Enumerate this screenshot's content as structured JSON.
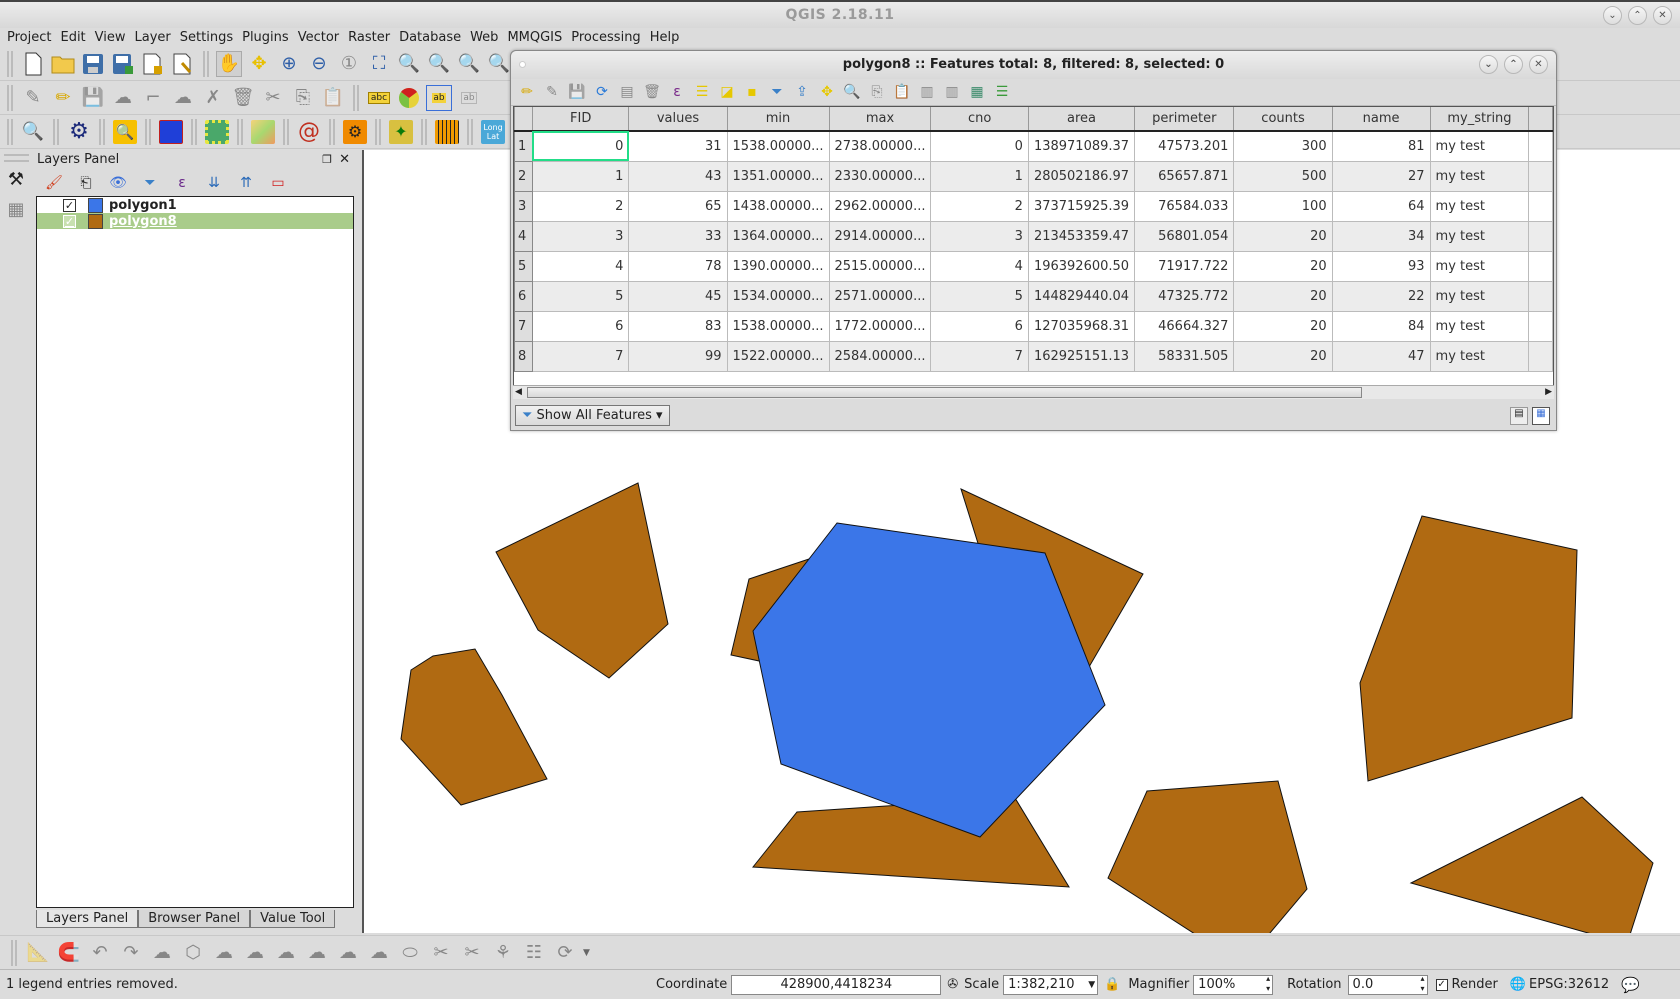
{
  "window": {
    "title": "QGIS 2.18.11",
    "controls": [
      "minimize",
      "maximize",
      "close"
    ]
  },
  "menu": [
    "Project",
    "Edit",
    "View",
    "Layer",
    "Settings",
    "Plugins",
    "Vector",
    "Raster",
    "Database",
    "Web",
    "MMQGIS",
    "Processing",
    "Help"
  ],
  "toolbar1": [
    "new-project-icon",
    "open-project-icon",
    "save-project-icon",
    "save-as-icon",
    "new-print-composer-icon",
    "composer-manager-icon",
    "pan-icon",
    "pan-to-selection-icon",
    "zoom-in-icon",
    "zoom-out-icon",
    "zoom-native-icon",
    "zoom-full-icon",
    "zoom-to-selection-icon",
    "zoom-to-layer-icon",
    "zoom-last-icon",
    "zoom-next-icon"
  ],
  "toolbar2": [
    "current-edits-icon",
    "toggle-editing-icon",
    "save-edits-icon",
    "add-feature-icon",
    "node-tool-icon",
    "move-feature-icon",
    "delete-part-icon",
    "delete-selected-icon",
    "cut-features-icon",
    "copy-features-icon",
    "paste-features-icon",
    "label-icon",
    "diagram-icon",
    "pin-labels-icon",
    "show-hide-labels-icon"
  ],
  "toolbar3": {
    "long_lat_label": "Long\nLat",
    "icons": [
      "geoprocessing-search-icon",
      "processing-gear-icon",
      "search-plugin-icon",
      "network-plugin-icon",
      "grid-plugin-icon",
      "heatmap-plugin-icon",
      "spiral-plugin-icon",
      "processing-toolbox-icon",
      "georeferencer-icon",
      "profile-tool-icon",
      "long-lat-icon"
    ]
  },
  "layers_panel": {
    "title": "Layers Panel",
    "layers": [
      {
        "name": "polygon1",
        "checked": true,
        "color": "#3b76e8",
        "selected": false
      },
      {
        "name": "polygon8",
        "checked": true,
        "color": "#b06a12",
        "selected": true
      }
    ],
    "tabs": [
      "Layers Panel",
      "Browser Panel",
      "Value Tool"
    ],
    "active_tab": "Layers Panel"
  },
  "attribute_table": {
    "title": "polygon8 :: Features total: 8, filtered: 8, selected: 0",
    "columns": [
      "FID",
      "values",
      "min",
      "max",
      "cno",
      "area",
      "perimeter",
      "counts",
      "name",
      "my_string"
    ],
    "rows": [
      [
        "0",
        "31",
        "1538.00000...",
        "2738.00000...",
        "0",
        "138971089.37",
        "47573.201",
        "300",
        "81",
        "my test"
      ],
      [
        "1",
        "43",
        "1351.00000...",
        "2330.00000...",
        "1",
        "280502186.97",
        "65657.871",
        "500",
        "27",
        "my test"
      ],
      [
        "2",
        "65",
        "1438.00000...",
        "2962.00000...",
        "2",
        "373715925.39",
        "76584.033",
        "100",
        "64",
        "my test"
      ],
      [
        "3",
        "33",
        "1364.00000...",
        "2914.00000...",
        "3",
        "213453359.47",
        "56801.054",
        "20",
        "34",
        "my test"
      ],
      [
        "4",
        "78",
        "1390.00000...",
        "2515.00000...",
        "4",
        "196392600.50",
        "71917.722",
        "20",
        "93",
        "my test"
      ],
      [
        "5",
        "45",
        "1534.00000...",
        "2571.00000...",
        "5",
        "144829440.04",
        "47325.772",
        "20",
        "22",
        "my test"
      ],
      [
        "6",
        "83",
        "1538.00000...",
        "1772.00000...",
        "6",
        "127035968.31",
        "46664.327",
        "20",
        "84",
        "my test"
      ],
      [
        "7",
        "99",
        "1522.00000...",
        "2584.00000...",
        "7",
        "162925151.13",
        "58331.505",
        "20",
        "47",
        "my test"
      ]
    ],
    "filter_button": "Show All Features"
  },
  "map": {
    "fill_polygon8": "#b06a12",
    "fill_polygon1": "#3b76e8"
  },
  "status": {
    "message": "1 legend entries removed.",
    "coordinate_label": "Coordinate",
    "coordinate": "428900,4418234",
    "scale_label": "Scale",
    "scale": "1:382,210",
    "magnifier_label": "Magnifier",
    "magnifier": "100%",
    "rotation_label": "Rotation",
    "rotation": "0.0",
    "render_label": "Render",
    "render_checked": true,
    "crs": "EPSG:32612"
  }
}
